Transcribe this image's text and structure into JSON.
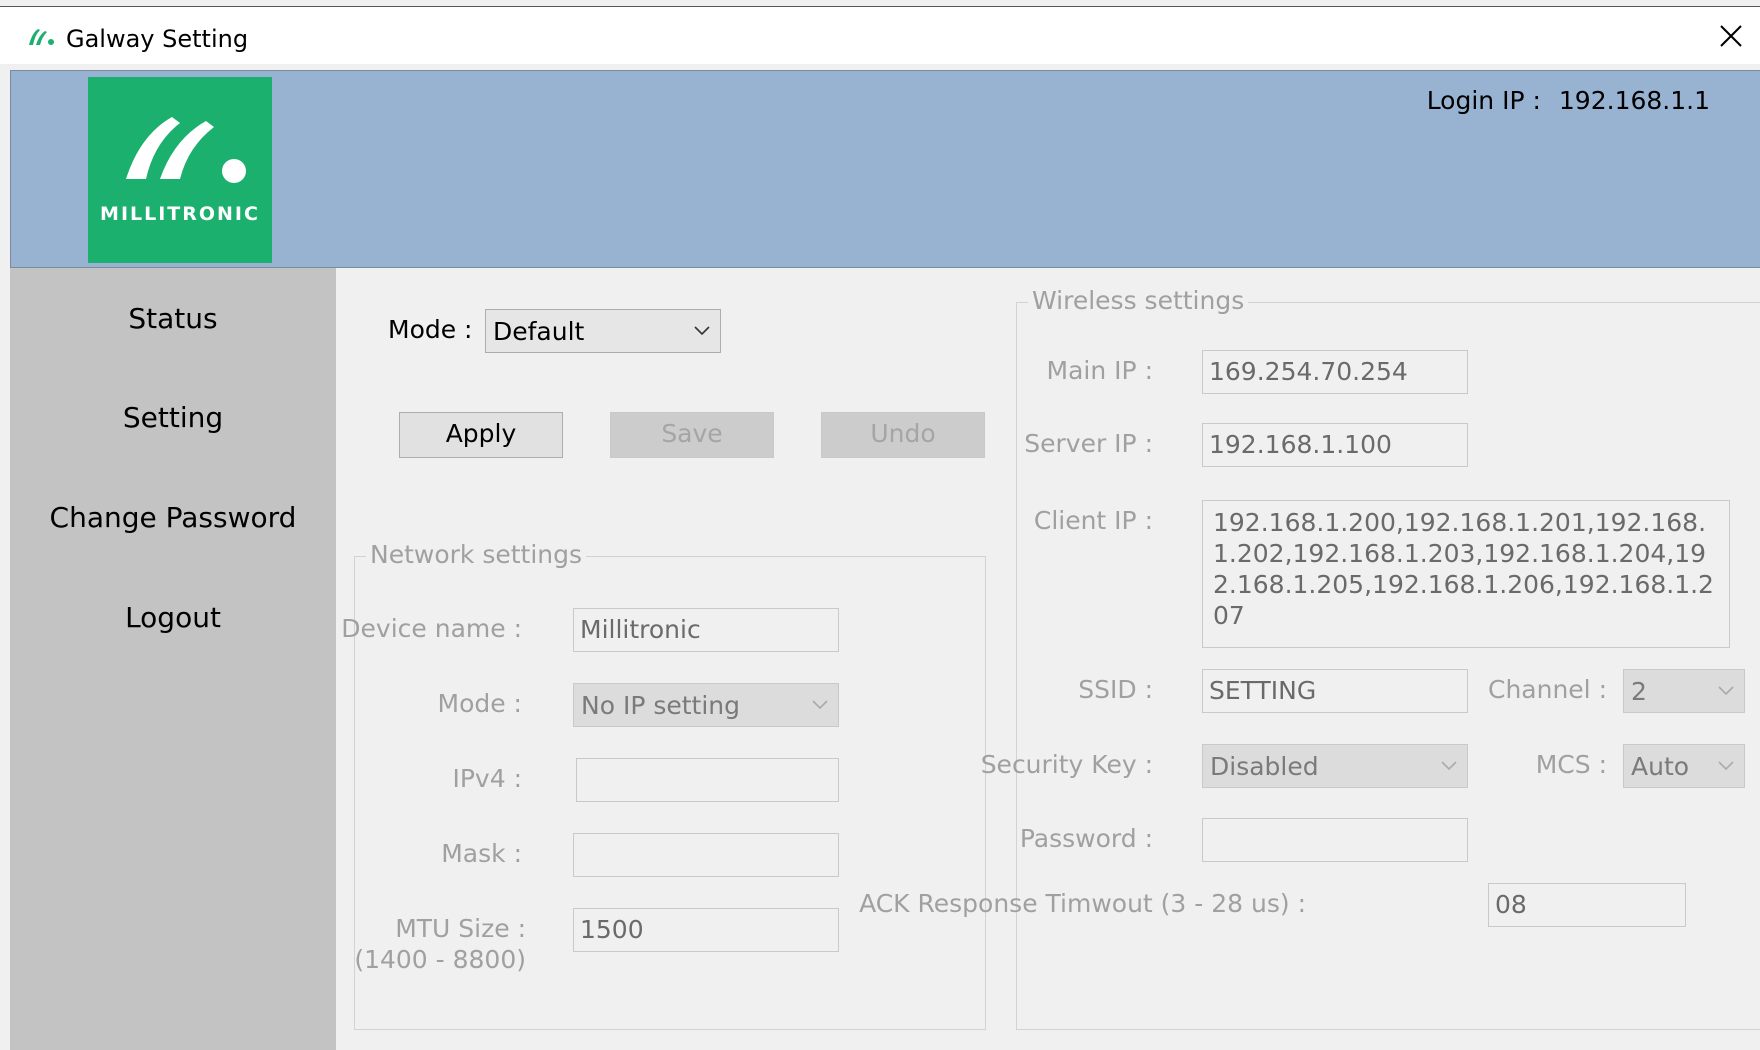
{
  "window": {
    "title": "Galway Setting"
  },
  "header": {
    "logo_text": "MILLITRONIC",
    "login_ip_label": "Login IP :",
    "login_ip_value": "192.168.1.1",
    "background_color": "#98b3d2",
    "logo_color": "#1bb06e"
  },
  "sidebar": {
    "items": [
      {
        "label": "Status"
      },
      {
        "label": "Setting"
      },
      {
        "label": "Change Password"
      },
      {
        "label": "Logout"
      }
    ]
  },
  "top_controls": {
    "mode_label": "Mode :",
    "mode_value": "Default",
    "apply_label": "Apply",
    "save_label": "Save",
    "undo_label": "Undo"
  },
  "network": {
    "legend": "Network settings",
    "device_name_label": "Device name :",
    "device_name_value": "Millitronic",
    "mode_label": "Mode :",
    "mode_value": "No IP setting",
    "ipv4_label": "IPv4 :",
    "ipv4_value": "",
    "mask_label": "Mask :",
    "mask_value": "",
    "mtu_label": "MTU Size :",
    "mtu_range": "(1400 - 8800)",
    "mtu_value": "1500"
  },
  "wireless": {
    "legend": "Wireless settings",
    "main_ip_label": "Main IP :",
    "main_ip_value": "169.254.70.254",
    "server_ip_label": "Server IP :",
    "server_ip_value": "192.168.1.100",
    "client_ip_label": "Client IP :",
    "client_ip_value": "192.168.1.200,192.168.1.201,192.168.1.202,192.168.1.203,192.168.1.204,192.168.1.205,192.168.1.206,192.168.1.207",
    "ssid_label": "SSID :",
    "ssid_value": "SETTING",
    "channel_label": "Channel :",
    "channel_value": "2",
    "security_key_label": "Security Key :",
    "security_key_value": "Disabled",
    "mcs_label": "MCS :",
    "mcs_value": "Auto",
    "password_label": "Password :",
    "password_value": "",
    "ack_label": "ACK Response Timwout (3 - 28 us) :",
    "ack_value": "08"
  },
  "icons": {
    "app_icon": "millitronic-logo-icon",
    "close": "close-icon",
    "chevron": "chevron-down-icon"
  }
}
